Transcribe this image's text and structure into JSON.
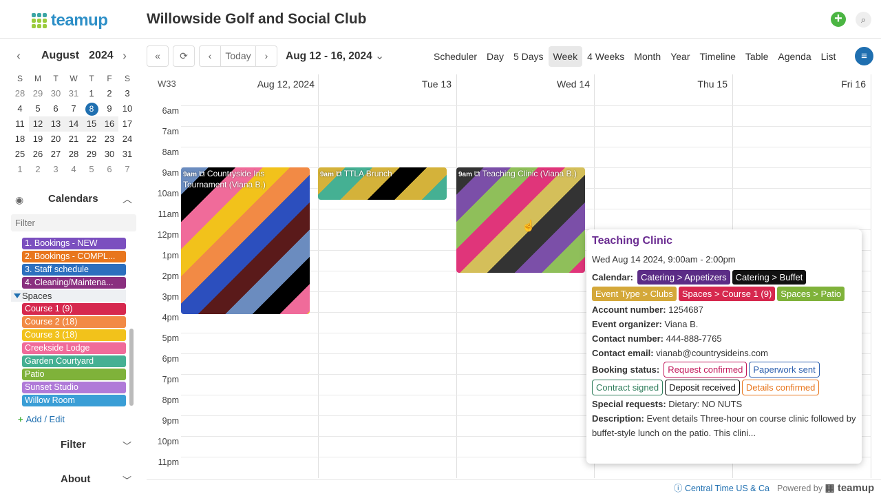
{
  "app": {
    "logo_text": "teamup",
    "club_title": "Willowside Golf and Social Club"
  },
  "mini_calendar": {
    "month": "August",
    "year": "2024",
    "dow": [
      "S",
      "M",
      "T",
      "W",
      "T",
      "F",
      "S"
    ],
    "weeks": [
      [
        "28",
        "29",
        "30",
        "31",
        "1",
        "2",
        "3"
      ],
      [
        "4",
        "5",
        "6",
        "7",
        "8",
        "9",
        "10"
      ],
      [
        "11",
        "12",
        "13",
        "14",
        "15",
        "16",
        "17"
      ],
      [
        "18",
        "19",
        "20",
        "21",
        "22",
        "23",
        "24"
      ],
      [
        "25",
        "26",
        "27",
        "28",
        "29",
        "30",
        "31"
      ],
      [
        "1",
        "2",
        "3",
        "4",
        "5",
        "6",
        "7"
      ]
    ],
    "today": "8"
  },
  "sidebar": {
    "calendars_title": "Calendars",
    "filter_placeholder": "Filter",
    "items": [
      {
        "label": "1. Bookings - NEW",
        "color": "#7b4fbf"
      },
      {
        "label": "2. Bookings - COMPL...",
        "color": "#e8761d"
      },
      {
        "label": "3. Staff schedule",
        "color": "#2c6fbe"
      },
      {
        "label": "4. Cleaning/Maintena...",
        "color": "#8a2f7f"
      }
    ],
    "group": "Spaces",
    "spaces": [
      {
        "label": "Course 1 (9)",
        "color": "#d6284e"
      },
      {
        "label": "Course 2 (18)",
        "color": "#f28a45"
      },
      {
        "label": "Course 3 (18)",
        "color": "#f2c21b"
      },
      {
        "label": "Creekside Lodge",
        "color": "#f06b9a"
      },
      {
        "label": "Garden Courtyard",
        "color": "#45b093"
      },
      {
        "label": "Patio",
        "color": "#7fb23a"
      },
      {
        "label": "Sunset Studio",
        "color": "#b07ad8"
      },
      {
        "label": "Willow Room",
        "color": "#3a9ed6"
      }
    ],
    "add_edit": "Add / Edit",
    "filter_section": "Filter",
    "about_section": "About"
  },
  "toolbar": {
    "today": "Today",
    "range": "Aug 12 - 16, 2024",
    "views": [
      "Scheduler",
      "Day",
      "5 Days",
      "Week",
      "4 Weeks",
      "Month",
      "Year",
      "Timeline",
      "Table",
      "Agenda",
      "List"
    ],
    "active_view": "Week"
  },
  "grid": {
    "week_label": "W33",
    "days": [
      "Aug 12, 2024",
      "Tue 13",
      "Wed 14",
      "Thu 15",
      "Fri 16"
    ],
    "hours": [
      "6am",
      "7am",
      "8am",
      "9am",
      "10am",
      "11am",
      "12pm",
      "1pm",
      "2pm",
      "3pm",
      "4pm",
      "5pm",
      "6pm",
      "7pm",
      "8pm",
      "9pm",
      "10pm",
      "11pm"
    ]
  },
  "events": [
    {
      "time": "9am",
      "title": "Countryside Ins Tournament (Viana B.)",
      "colors": [
        "#6b8cbf",
        "#000000",
        "#f06b9a",
        "#f2c21b",
        "#f28a45",
        "#2c4fbe",
        "#5a1a1a"
      ]
    },
    {
      "time": "9am",
      "title": "TTLA Brunch",
      "colors": [
        "#d4b23a",
        "#45b093",
        "#d4b23a",
        "#000000"
      ]
    },
    {
      "time": "9am",
      "title": "Teaching Clinic (Viana B.)",
      "colors": [
        "#333333",
        "#7b4fa8",
        "#8fbf5a",
        "#e0357a",
        "#d4bf5a"
      ]
    }
  ],
  "popup": {
    "title": "Teaching Clinic",
    "date": "Wed Aug 14 2024, 9:00am - 2:00pm",
    "calendar_label": "Calendar:",
    "calendar_tags": [
      {
        "label": "Catering > Appetizers",
        "color": "#5b2c86"
      },
      {
        "label": "Catering > Buffet",
        "color": "#111111"
      },
      {
        "label": "Event Type > Clubs",
        "color": "#d4a83a"
      },
      {
        "label": "Spaces > Course 1 (9)",
        "color": "#d6284e"
      },
      {
        "label": "Spaces > Patio",
        "color": "#7fb23a"
      }
    ],
    "account_label": "Account number:",
    "account": "1254687",
    "organizer_label": "Event organizer:",
    "organizer": "Viana B.",
    "contact_label": "Contact number:",
    "contact": "444-888-7765",
    "email_label": "Contact email:",
    "email": "vianab@countrysideins.com",
    "status_label": "Booking status:",
    "status_tags": [
      {
        "label": "Request confirmed",
        "color": "#c2185b"
      },
      {
        "label": "Paperwork sent",
        "color": "#2c5fae"
      },
      {
        "label": "Contract signed",
        "color": "#2e7d5b"
      },
      {
        "label": "Deposit received",
        "color": "#111111"
      },
      {
        "label": "Details confirmed",
        "color": "#e8761d"
      }
    ],
    "special_label": "Special requests:",
    "special": "Dietary: NO NUTS",
    "desc_label": "Description:",
    "desc": "Event details Three-hour on course clinic followed by buffet-style lunch on the patio. This clini..."
  },
  "footer": {
    "timezone": "Central Time US & Ca",
    "powered": "Powered by",
    "brand": "teamup"
  }
}
